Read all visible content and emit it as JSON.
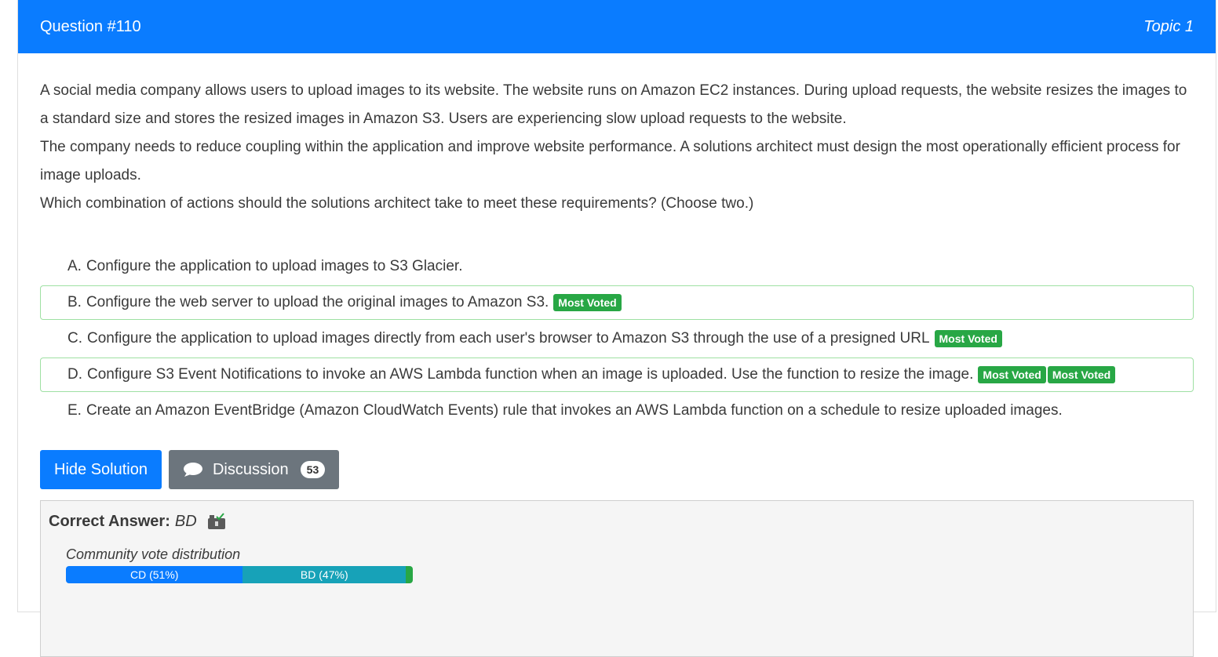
{
  "header": {
    "title": "Question #110",
    "topic": "Topic 1"
  },
  "question": {
    "paragraphs": [
      "A social media company allows users to upload images to its website. The website runs on Amazon EC2 instances. During upload requests, the website resizes the images to a standard size and stores the resized images in Amazon S3. Users are experiencing slow upload requests to the website.",
      "The company needs to reduce coupling within the application and improve website performance. A solutions architect must design the most operationally efficient process for image uploads.",
      "Which combination of actions should the solutions architect take to meet these requirements? (Choose two.)"
    ]
  },
  "choices": [
    {
      "letter": "A.",
      "text": "Configure the application to upload images to S3 Glacier."
    },
    {
      "letter": "B.",
      "text": "Configure the web server to upload the original images to Amazon S3.",
      "badge1": "Most Voted"
    },
    {
      "letter": "C.",
      "text": "Configure the application to upload images directly from each user's browser to Amazon S3 through the use of a presigned URL",
      "badge1": "Most Voted"
    },
    {
      "letter": "D.",
      "text": "Configure S3 Event Notifications to invoke an AWS Lambda function when an image is uploaded. Use the function to resize the image.",
      "badge1": "Most Voted",
      "badge2": "Most Voted"
    },
    {
      "letter": "E.",
      "text": "Create an Amazon EventBridge (Amazon CloudWatch Events) rule that invokes an AWS Lambda function on a schedule to resize uploaded images."
    }
  ],
  "buttons": {
    "hide_solution": "Hide Solution",
    "discussion": "Discussion",
    "discussion_count": "53"
  },
  "answer": {
    "label": "Correct Answer:",
    "value": "BD"
  },
  "vote_distribution": {
    "title": "Community vote distribution",
    "segments": [
      {
        "label": "CD (51%)",
        "percent": 51,
        "color": "#0a7cff"
      },
      {
        "label": "BD (47%)",
        "percent": 47,
        "color": "#17a2b8"
      },
      {
        "label": "",
        "percent": 2,
        "color": "#28a745"
      }
    ]
  },
  "colors": {
    "primary": "#0a7cff",
    "success": "#28a745",
    "info": "#17a2b8",
    "secondary": "#6c757d"
  },
  "icons": {
    "discussion": "chat-bubble-icon",
    "reveal": "reveal-solution-icon"
  }
}
